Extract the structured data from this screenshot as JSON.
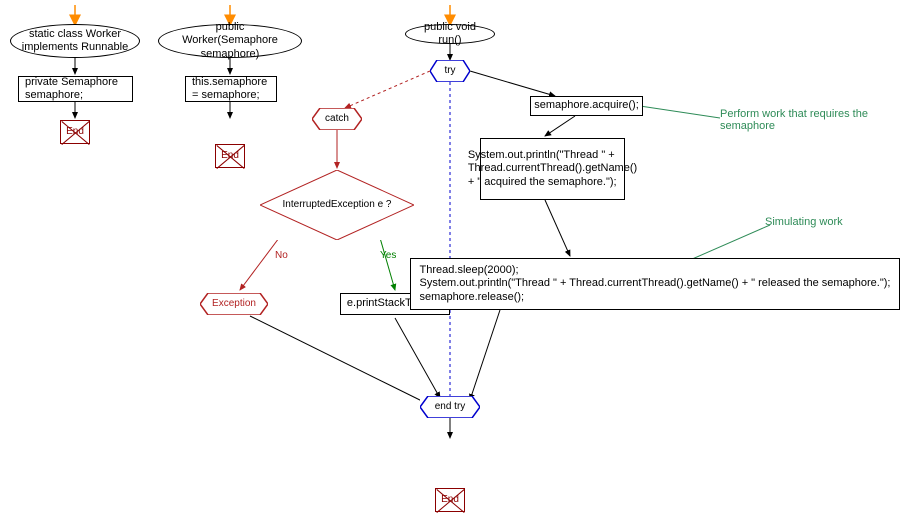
{
  "flowchart1": {
    "start": "static class Worker implements Runnable",
    "stmt": "private Semaphore semaphore;",
    "end": "End"
  },
  "flowchart2": {
    "start": "public Worker(Semaphore semaphore)",
    "stmt": "this.semaphore = semaphore;",
    "end": "End"
  },
  "flowchart3": {
    "start": "public void run()",
    "try": "try",
    "acquire": "semaphore.acquire();",
    "println1": "System.out.println(\"Thread \" + Thread.currentThread().getName() + \" acquired the semaphore.\");",
    "sleepBlock": "Thread.sleep(2000);\nSystem.out.println(\"Thread \" + Thread.currentThread().getName() + \" released the semaphore.\");\nsemaphore.release();",
    "catch": "catch",
    "condition": "InterruptedException e ?",
    "no": "No",
    "yes": "Yes",
    "exception": "Exception",
    "printStack": "e.printStackTrace();",
    "endtry": "end try",
    "end": "End",
    "comment1": "Perform work that requires the semaphore",
    "comment2": "Simulating work"
  }
}
